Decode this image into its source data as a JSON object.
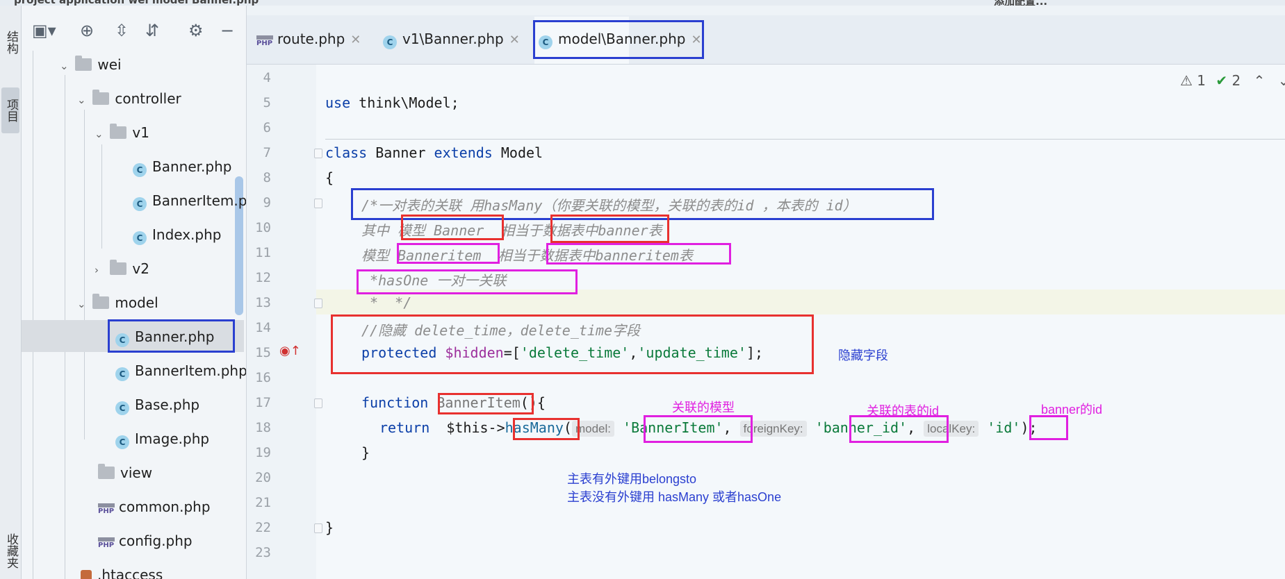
{
  "topbar": {
    "left": "project   application   wei   model   Banner.php",
    "right": "添加配置..."
  },
  "toolstrip": {
    "structure": "结构",
    "project": "项目",
    "favorites": "收藏夹"
  },
  "project_tree": [
    {
      "label": "wei",
      "kind": "folder"
    },
    {
      "label": "controller",
      "kind": "folder"
    },
    {
      "label": "v1",
      "kind": "folder"
    },
    {
      "label": "Banner.php",
      "kind": "class"
    },
    {
      "label": "BannerItem.php",
      "kind": "class"
    },
    {
      "label": "Index.php",
      "kind": "class"
    },
    {
      "label": "v2",
      "kind": "folder"
    },
    {
      "label": "model",
      "kind": "folder"
    },
    {
      "label": "Banner.php",
      "kind": "class",
      "selected": true
    },
    {
      "label": "BannerItem.php",
      "kind": "class"
    },
    {
      "label": "Base.php",
      "kind": "class"
    },
    {
      "label": "Image.php",
      "kind": "class"
    },
    {
      "label": "view",
      "kind": "folder"
    },
    {
      "label": "common.php",
      "kind": "php"
    },
    {
      "label": "config.php",
      "kind": "php"
    },
    {
      "label": ".htaccess",
      "kind": "file"
    }
  ],
  "tabs": [
    {
      "label": "route.php",
      "icon": "php-file-icon"
    },
    {
      "label": "v1\\Banner.php",
      "icon": "class-icon"
    },
    {
      "label": "model\\Banner.php",
      "icon": "class-icon",
      "active": true
    }
  ],
  "inspections": {
    "warnings": "1",
    "checks": "2"
  },
  "line_numbers": [
    "4",
    "5",
    "6",
    "7",
    "8",
    "9",
    "10",
    "11",
    "12",
    "13",
    "14",
    "15",
    "16",
    "17",
    "18",
    "19",
    "20",
    "21",
    "22",
    "23"
  ],
  "code": {
    "l5_kw": "use",
    "l5_rest": " think\\Model;",
    "l7_kw1": "class",
    "l7_name": " Banner ",
    "l7_kw2": "extends",
    "l7_rest": " Model",
    "l8": "{",
    "l9": "/*一对表的关联 用hasMany（你要关联的模型，关联的表的id ，本表的 id）",
    "l10": "其中 模型 Banner  相当于数据表中banner表",
    "l11": "模型 Banneritem  相当于数据表中banneritem表",
    "l12": " *hasOne 一对一关联",
    "l13": " *  */",
    "l14": "//隐藏 delete_time，delete_time字段",
    "l15_kw": "protected",
    "l15_var": " $hidden",
    "l15_a": "=[",
    "l15_s1": "'delete_time'",
    "l15_b": ",",
    "l15_s2": "'update_time'",
    "l15_c": "];",
    "l17_kw": "function",
    "l17_name": " BannerItem",
    "l17_rest": "(){",
    "l18_kw": "return",
    "l18_this": "  $this->",
    "l18_fn": "hasMany",
    "l18_p": "(",
    "hint_model": "model:",
    "l18_s1": "'BannerItem'",
    "hint_fk": "foreignKey:",
    "l18_s2": "'banner_id'",
    "hint_lk": "localKey:",
    "l18_s3": "'id'",
    "l18_end": ");",
    "l19": "}",
    "l22": "}"
  },
  "annotations": {
    "hidden_fields": "隐藏字段",
    "related_model": "关联的模型",
    "related_table_id": "关联的表的id",
    "banner_id": "banner的id",
    "note1": "主表有外键用belongsto",
    "note2": "主表没有外键用 hasMany 或者hasOne"
  },
  "colors": {
    "red": "#e8312f",
    "magenta": "#e020e0",
    "blue": "#2a3fd0"
  }
}
